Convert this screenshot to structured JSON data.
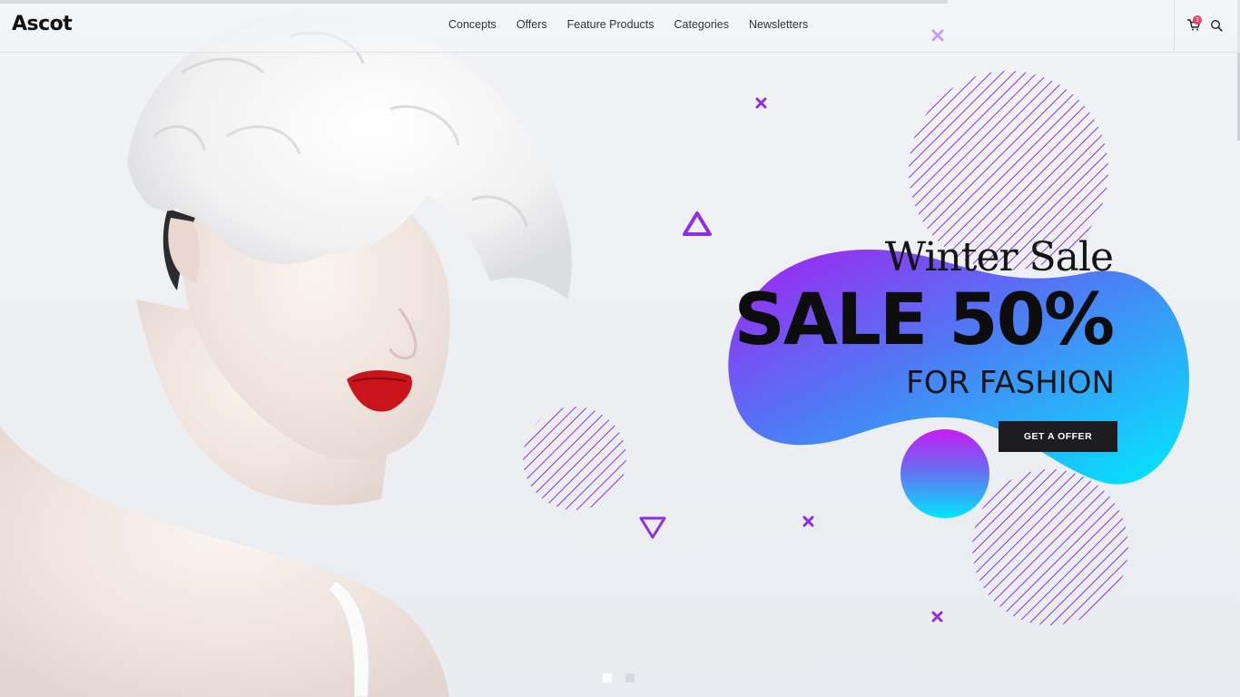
{
  "brand": {
    "name": "Ascot"
  },
  "nav": {
    "items": [
      {
        "label": "Concepts"
      },
      {
        "label": "Offers"
      },
      {
        "label": "Feature Products"
      },
      {
        "label": "Categories"
      },
      {
        "label": "Newsletters"
      }
    ]
  },
  "header": {
    "cart_icon": "cart-icon",
    "cart_count": "3",
    "search_icon": "search-icon"
  },
  "hero": {
    "script_title": "Winter Sale",
    "headline": "SALE 50%",
    "subline": "FOR FASHION",
    "cta_label": "GET A OFFER"
  },
  "slider": {
    "slides": 2,
    "active": 1
  },
  "colors": {
    "accent_purple": "#9b2cf0",
    "accent_cyan": "#00e5ff",
    "cta_bg": "#1d1d1f",
    "badge": "#ee3d6b"
  }
}
